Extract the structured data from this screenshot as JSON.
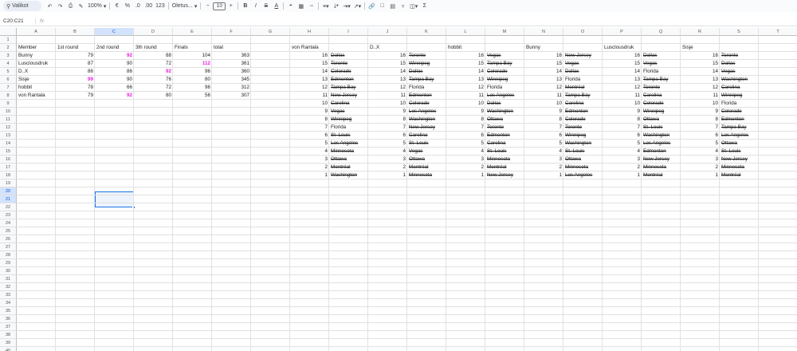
{
  "toolbar": {
    "search": "Valikot",
    "zoom": "100%",
    "currency": "€",
    "percent": "%",
    "dec_less": ".0",
    "dec_more": ".00",
    "format123": "123",
    "font": "Oletus...",
    "fontsize": "10",
    "minus": "−",
    "plus": "+",
    "bold": "B",
    "italic": "I",
    "strike": "S",
    "textcolor": "A",
    "sum": "Σ"
  },
  "namebox": "C20:C21",
  "fx": "fx",
  "columns": [
    "A",
    "B",
    "C",
    "D",
    "E",
    "F",
    "G",
    "H",
    "I",
    "J",
    "K",
    "L",
    "M",
    "N",
    "O",
    "P",
    "Q",
    "R",
    "S",
    "T"
  ],
  "selected_column": "C",
  "rows": [
    "1",
    "2",
    "3",
    "4",
    "5",
    "6",
    "7",
    "8",
    "9",
    "10",
    "11",
    "12",
    "13",
    "14",
    "15",
    "16",
    "17",
    "18",
    "19",
    "20",
    "21",
    "22",
    "23",
    "24",
    "25",
    "26",
    "27",
    "28",
    "29",
    "30",
    "31",
    "32",
    "33",
    "34",
    "35",
    "36",
    "37",
    "38",
    "39",
    "40"
  ],
  "selected_rows": [
    "20",
    "21"
  ],
  "header_row": {
    "member": "Member",
    "r1": "1st round",
    "r2": "2nd round",
    "r3": "3th round",
    "finals": "Finals",
    "total": "total",
    "h": "von Rantala",
    "j": "D..X",
    "l": "hobbit",
    "n": "Bunny",
    "p": "Lusclousdruk",
    "r": "Sisje"
  },
  "members": [
    {
      "name": "Bunny",
      "r1": "79",
      "r2": "92",
      "r2_mag": true,
      "r3": "88",
      "r3_mag": false,
      "r1_mag": false,
      "fin": "104",
      "fin_mag": false,
      "tot": "363"
    },
    {
      "name": "Lusclousdruk",
      "r1": "87",
      "r2": "90",
      "r2_mag": false,
      "r3": "72",
      "r3_mag": false,
      "r1_mag": false,
      "fin": "112",
      "fin_mag": true,
      "tot": "361"
    },
    {
      "name": "D..X",
      "r1": "86",
      "r2": "86",
      "r2_mag": false,
      "r3": "92",
      "r3_mag": true,
      "r1_mag": false,
      "fin": "96",
      "fin_mag": false,
      "tot": "360"
    },
    {
      "name": "Sisje",
      "r1": "99",
      "r2": "90",
      "r2_mag": false,
      "r3": "76",
      "r3_mag": false,
      "r1_mag": true,
      "fin": "80",
      "fin_mag": false,
      "tot": "345"
    },
    {
      "name": "hobbit",
      "r1": "78",
      "r2": "66",
      "r2_mag": false,
      "r3": "72",
      "r3_mag": false,
      "r1_mag": false,
      "fin": "96",
      "fin_mag": false,
      "tot": "312"
    },
    {
      "name": "von Rantala",
      "r1": "79",
      "r2": "92",
      "r2_mag": true,
      "r3": "80",
      "r3_mag": false,
      "r1_mag": false,
      "fin": "56",
      "fin_mag": false,
      "tot": "307"
    }
  ],
  "pick_numbers": [
    "16",
    "15",
    "14",
    "13",
    "12",
    "11",
    "10",
    "9",
    "8",
    "7",
    "6",
    "5",
    "4",
    "3",
    "2",
    "1"
  ],
  "picks": [
    {
      "col": "I",
      "teams": [
        [
          "Dallas",
          1
        ],
        [
          "Toronto",
          1
        ],
        [
          "Colorado",
          1
        ],
        [
          "Edmonton",
          1
        ],
        [
          "Tampa Bay",
          1
        ],
        [
          "New Jersey",
          1
        ],
        [
          "Carolina",
          1
        ],
        [
          "Vegas",
          1
        ],
        [
          "Winnipeg",
          1
        ],
        [
          "Florida",
          0
        ],
        [
          "St. Louis",
          1
        ],
        [
          "Los Angeles",
          1
        ],
        [
          "Minnesota",
          1
        ],
        [
          "Ottawa",
          1
        ],
        [
          "Montréal",
          1
        ],
        [
          "Washington",
          1
        ]
      ]
    },
    {
      "col": "K",
      "teams": [
        [
          "Toronto",
          1
        ],
        [
          "Winnipeg",
          1
        ],
        [
          "Dallas",
          1
        ],
        [
          "Tampa Bay",
          1
        ],
        [
          "Florida",
          0
        ],
        [
          "Edmonton",
          1
        ],
        [
          "Colorado",
          1
        ],
        [
          "Los Angeles",
          1
        ],
        [
          "Washington",
          1
        ],
        [
          "New Jersey",
          1
        ],
        [
          "Carolina",
          1
        ],
        [
          "St. Louis",
          1
        ],
        [
          "Vegas",
          1
        ],
        [
          "Ottawa",
          1
        ],
        [
          "Montréal",
          1
        ],
        [
          "Minnesota",
          1
        ]
      ]
    },
    {
      "col": "M",
      "teams": [
        [
          "Vegas",
          1
        ],
        [
          "Tampa Bay",
          1
        ],
        [
          "Colorado",
          1
        ],
        [
          "Winnipeg",
          1
        ],
        [
          "Florida",
          0
        ],
        [
          "Los Angeles",
          1
        ],
        [
          "Dallas",
          1
        ],
        [
          "Washington",
          1
        ],
        [
          "Ottawa",
          1
        ],
        [
          "Toronto",
          1
        ],
        [
          "Edmonton",
          1
        ],
        [
          "Carolina",
          1
        ],
        [
          "St. Louis",
          1
        ],
        [
          "Minnesota",
          1
        ],
        [
          "Montréal",
          1
        ],
        [
          "New Jersey",
          1
        ]
      ]
    },
    {
      "col": "O",
      "teams": [
        [
          "New Jersey",
          1
        ],
        [
          "Vegas",
          1
        ],
        [
          "Dallas",
          1
        ],
        [
          "Florida",
          0
        ],
        [
          "Montréal",
          1
        ],
        [
          "Tampa Bay",
          1
        ],
        [
          "Carolina",
          1
        ],
        [
          "Edmonton",
          1
        ],
        [
          "Colorado",
          1
        ],
        [
          "Toronto",
          1
        ],
        [
          "Winnipeg",
          1
        ],
        [
          "Washington",
          1
        ],
        [
          "St. Louis",
          1
        ],
        [
          "Ottawa",
          1
        ],
        [
          "Minnesota",
          1
        ],
        [
          "Los Angeles",
          1
        ]
      ]
    },
    {
      "col": "Q",
      "teams": [
        [
          "Dallas",
          1
        ],
        [
          "Vegas",
          1
        ],
        [
          "Florida",
          0
        ],
        [
          "Tampa Bay",
          1
        ],
        [
          "Toronto",
          1
        ],
        [
          "Carolina",
          1
        ],
        [
          "Colorado",
          1
        ],
        [
          "Winnipeg",
          1
        ],
        [
          "Ottawa",
          1
        ],
        [
          "St. Louis",
          1
        ],
        [
          "Washington",
          1
        ],
        [
          "Los Angeles",
          1
        ],
        [
          "Edmonton",
          1
        ],
        [
          "New Jersey",
          1
        ],
        [
          "Minnesota",
          1
        ],
        [
          "Montréal",
          1
        ]
      ]
    },
    {
      "col": "S",
      "teams": [
        [
          "Toronto",
          1
        ],
        [
          "Dallas",
          1
        ],
        [
          "Vegas",
          1
        ],
        [
          "Washington",
          1
        ],
        [
          "Carolina",
          1
        ],
        [
          "Winnipeg",
          1
        ],
        [
          "Florida",
          0
        ],
        [
          "Colorado",
          1
        ],
        [
          "Edmonton",
          1
        ],
        [
          "Tampa Bay",
          1
        ],
        [
          "Los Angeles",
          1
        ],
        [
          "Ottawa",
          1
        ],
        [
          "St. Louis",
          1
        ],
        [
          "New Jersey",
          1
        ],
        [
          "Minnesota",
          1
        ],
        [
          "Montréal",
          1
        ]
      ]
    }
  ]
}
